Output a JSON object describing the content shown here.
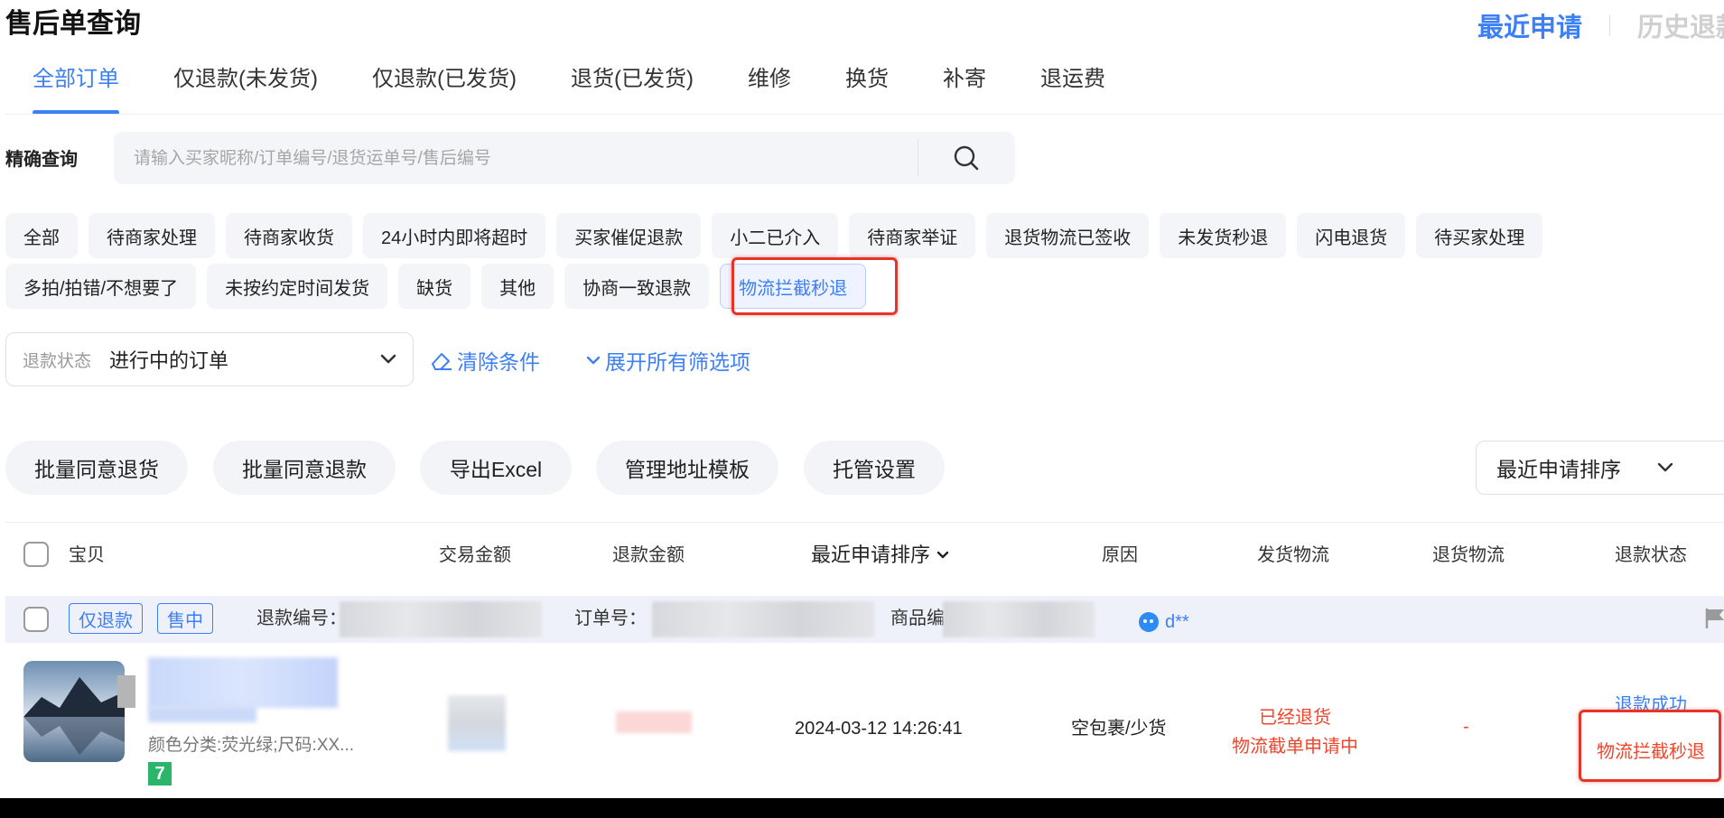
{
  "header": {
    "title": "售后单查询",
    "tab_recent": "最近申请",
    "tab_history": "历史退款"
  },
  "category_tabs": [
    {
      "label": "全部订单",
      "active": true
    },
    {
      "label": "仅退款(未发货)"
    },
    {
      "label": "仅退款(已发货)"
    },
    {
      "label": "退货(已发货)"
    },
    {
      "label": "维修"
    },
    {
      "label": "换货"
    },
    {
      "label": "补寄"
    },
    {
      "label": "退运费"
    }
  ],
  "search": {
    "label": "精确查询",
    "placeholder": "请输入买家昵称/订单编号/退货运单号/售后编号",
    "icon": "search-icon"
  },
  "filter_chips": {
    "row1": [
      "全部",
      "待商家处理",
      "待商家收货",
      "24小时内即将超时",
      "买家催促退款",
      "小二已介入",
      "待商家举证",
      "退货物流已签收",
      "未发货秒退",
      "闪电退货",
      "待买家处理"
    ],
    "row2": [
      "多拍/拍错/不想要了",
      "未按约定时间发货",
      "缺货",
      "其他",
      "协商一致退款",
      "物流拦截秒退"
    ],
    "selected": "物流拦截秒退"
  },
  "status_filter": {
    "label": "退款状态",
    "value": "进行中的订单",
    "clear_label": "清除条件",
    "expand_label": "展开所有筛选项"
  },
  "actions": {
    "batch_agree_return": "批量同意退货",
    "batch_agree_refund": "批量同意退款",
    "export_excel": "导出Excel",
    "manage_address_template": "管理地址模板",
    "hosting_settings": "托管设置",
    "sort_select": "最近申请排序"
  },
  "table": {
    "headers": {
      "item": "宝贝",
      "trade_amount": "交易金额",
      "refund_amount": "退款金额",
      "sort": "最近申请排序",
      "reason": "原因",
      "ship_logistics": "发货物流",
      "return_logistics": "退货物流",
      "refund_status": "退款状态"
    },
    "rows": [
      {
        "tag_type": "仅退款",
        "tag_stage": "售中",
        "refund_no_label": "退款编号：",
        "order_no_label": "订单号：",
        "item_no_label": "商品编号",
        "buyer_nick": "d**",
        "spec": "颜色分类:荧光绿;尺码:XX...",
        "badge": "7",
        "apply_time": "2024-03-12 14:26:41",
        "reason": "空包裹/少货",
        "ship_status_1": "已经退货",
        "ship_status_2": "物流截单申请中",
        "return_logistics": "-",
        "refund_status": "退款成功",
        "refund_tag": "物流拦截秒退"
      }
    ]
  },
  "colors": {
    "accent": "#3d7ff6",
    "danger": "#f1452c",
    "highlight": "#e5352b",
    "chip_bg": "#f4f5f8",
    "band_bg": "#eef1f9"
  }
}
